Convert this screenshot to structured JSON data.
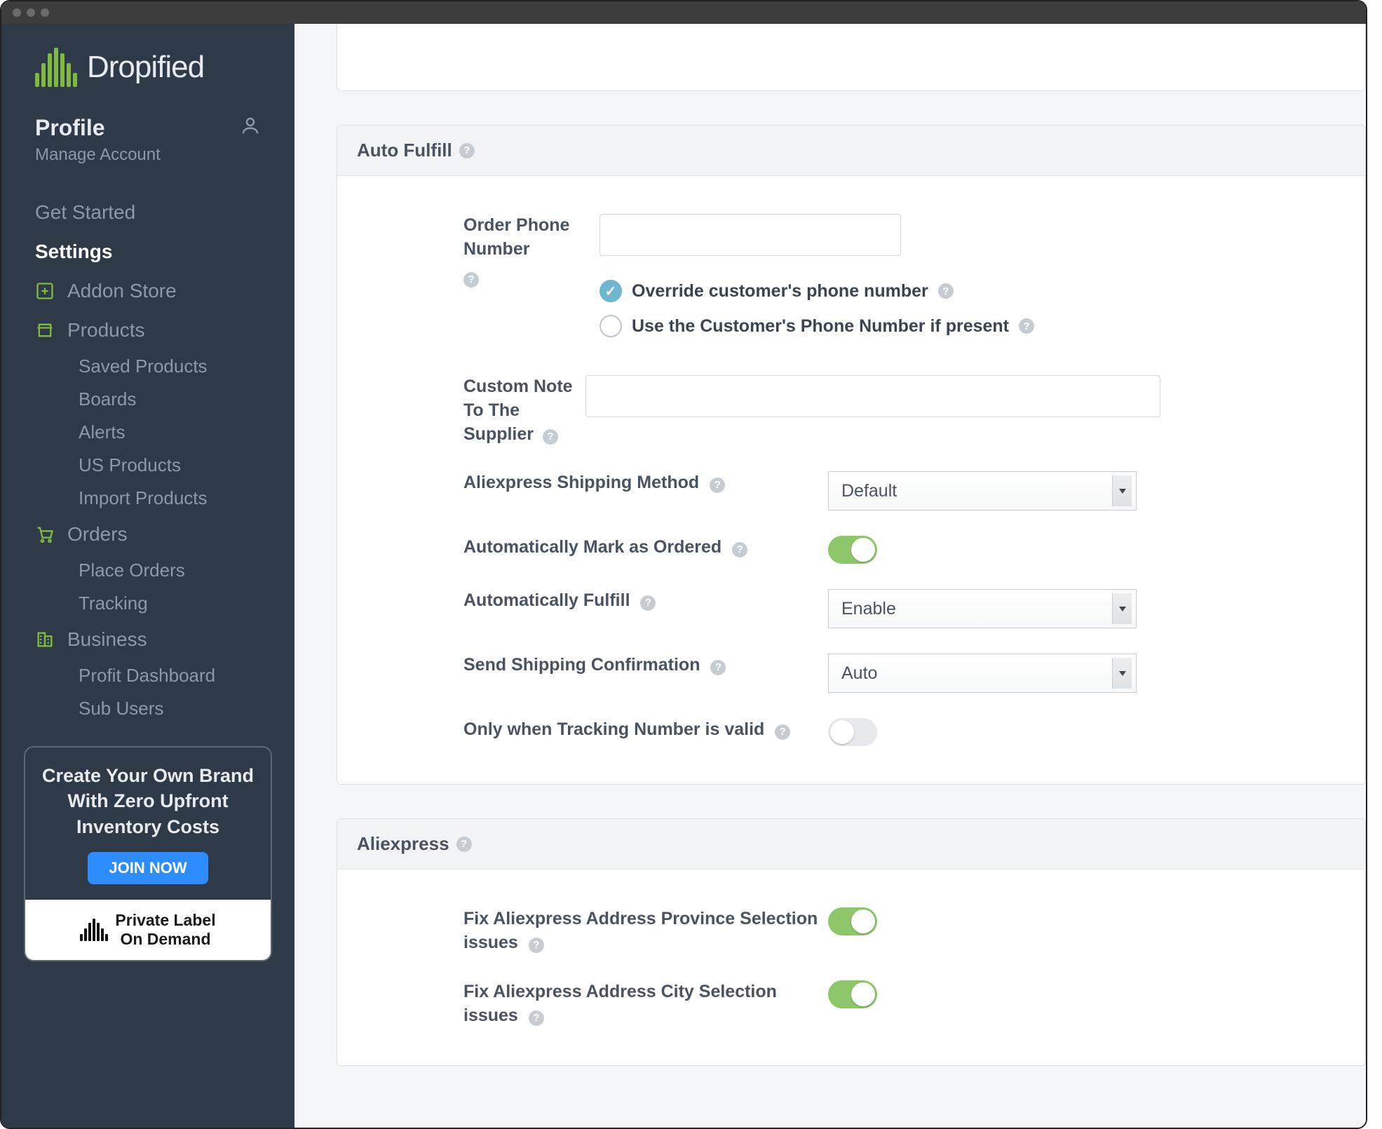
{
  "brand": "Dropified",
  "profile": {
    "title": "Profile",
    "subtitle": "Manage Account"
  },
  "nav": {
    "getStarted": "Get Started",
    "settings": "Settings",
    "addonStore": "Addon Store",
    "products": "Products",
    "products_sub": {
      "saved": "Saved Products",
      "boards": "Boards",
      "alerts": "Alerts",
      "us": "US Products",
      "import": "Import Products"
    },
    "orders": "Orders",
    "orders_sub": {
      "place": "Place Orders",
      "tracking": "Tracking"
    },
    "business": "Business",
    "business_sub": {
      "profit": "Profit Dashboard",
      "sub": "Sub Users"
    }
  },
  "promo": {
    "headline": "Create Your Own Brand With Zero Upfront Inventory Costs",
    "cta": "JOIN NOW",
    "footer1": "Private Label",
    "footer2": "On Demand"
  },
  "panels": {
    "autoFulfill": {
      "title": "Auto Fulfill",
      "fields": {
        "orderPhone": "Order Phone Number",
        "overridePhone": "Override customer's phone number",
        "useCustPhone": "Use the Customer's Phone Number if present",
        "customNote": "Custom Note To The Supplier",
        "aliShipping": "Aliexpress Shipping Method",
        "aliShippingValue": "Default",
        "autoMark": "Automatically Mark as Ordered",
        "autoFulfillLbl": "Automatically Fulfill",
        "autoFulfillValue": "Enable",
        "sendShip": "Send Shipping Confirmation",
        "sendShipValue": "Auto",
        "onlyTracking": "Only when Tracking Number is valid"
      }
    },
    "aliexpress": {
      "title": "Aliexpress",
      "fixProvince": "Fix Aliexpress Address Province Selection issues",
      "fixCity": "Fix Aliexpress Address City Selection issues"
    }
  }
}
